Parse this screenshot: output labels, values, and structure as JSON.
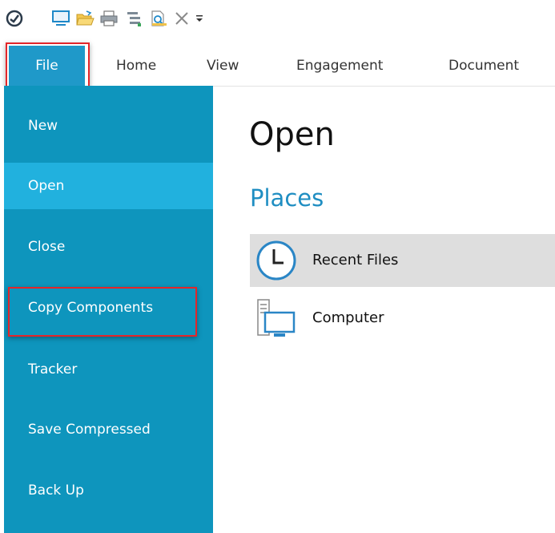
{
  "quick_access": {
    "icons": [
      "app-logo-icon",
      "monitor-icon",
      "open-folder-icon",
      "print-icon",
      "tree-icon",
      "print-preview-icon",
      "close-x-icon",
      "customize-dropdown-icon"
    ]
  },
  "ribbon": {
    "tabs": [
      {
        "label": "File",
        "active": true
      },
      {
        "label": "Home"
      },
      {
        "label": "View"
      },
      {
        "label": "Engagement"
      },
      {
        "label": "Document"
      }
    ]
  },
  "sidebar": {
    "items": [
      {
        "label": "New"
      },
      {
        "label": "Open",
        "active": true
      },
      {
        "label": "Close"
      },
      {
        "label": "Copy Components"
      },
      {
        "label": "Tracker"
      },
      {
        "label": "Save Compressed"
      },
      {
        "label": "Back Up"
      }
    ]
  },
  "main": {
    "title": "Open",
    "section": "Places",
    "places": [
      {
        "label": "Recent Files",
        "icon": "clock-icon",
        "selected": true
      },
      {
        "label": "Computer",
        "icon": "computer-icon"
      }
    ]
  },
  "colors": {
    "sidebar_bg": "#0e95bd",
    "sidebar_active": "#21b1de",
    "file_tab": "#1f99c9",
    "accent_text": "#1f8ec2",
    "highlight_box": "#e3262a"
  }
}
